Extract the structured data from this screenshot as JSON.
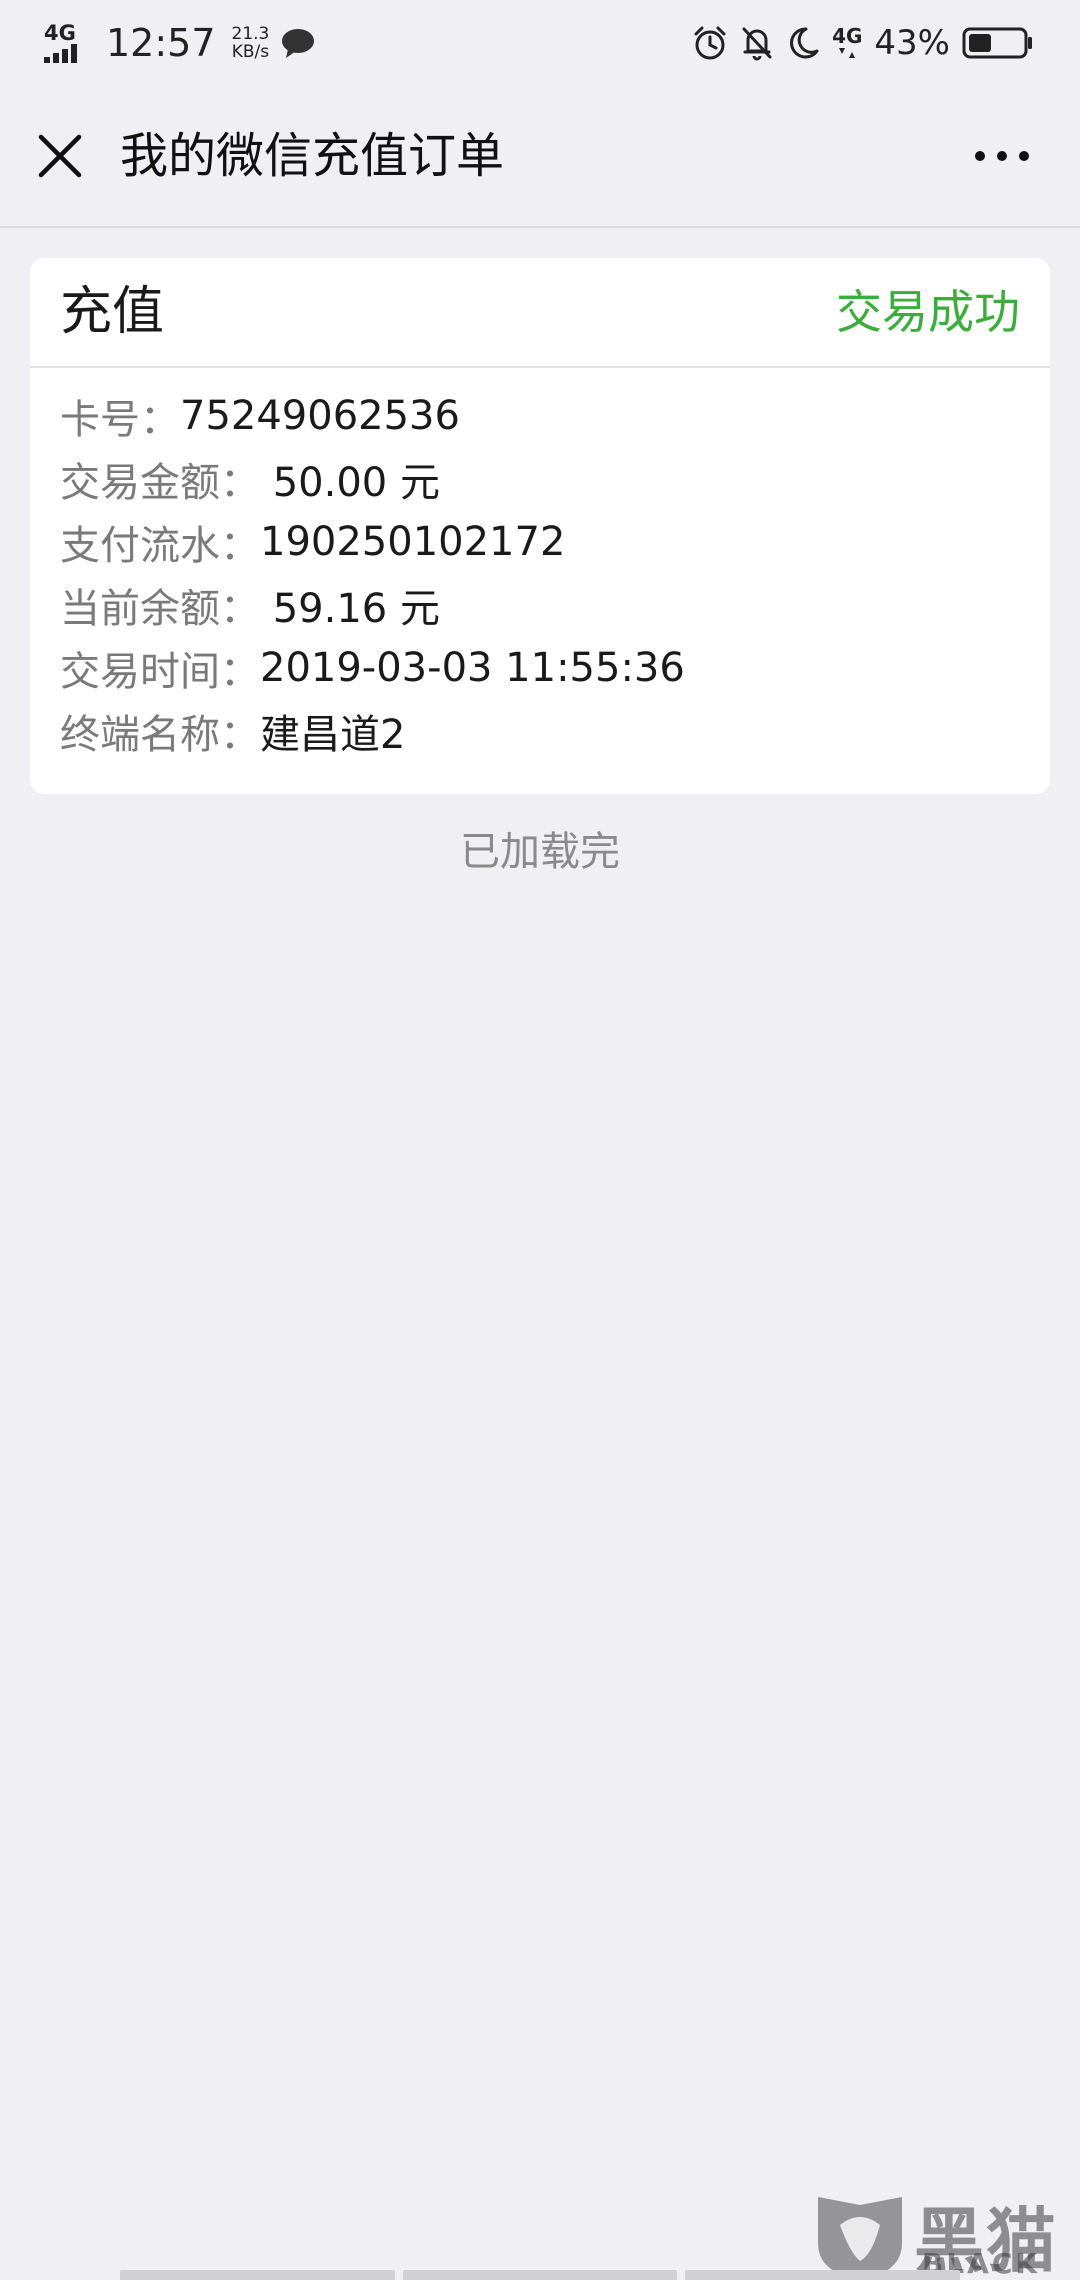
{
  "status_bar": {
    "network_type": "4G",
    "time": "12:57",
    "speed_value": "21.3",
    "speed_unit": "KB/s",
    "network_type_right": "4G",
    "battery_percent": "43%",
    "battery_level": 0.43,
    "icons": [
      "chat-bubble-icon",
      "alarm-icon",
      "bell-off-icon",
      "moon-icon",
      "battery-icon"
    ]
  },
  "nav": {
    "title": "我的微信充值订单",
    "close_icon": "close-icon",
    "more_icon": "more-icon"
  },
  "order": {
    "title": "充值",
    "status": "交易成功",
    "status_color": "#3aad3a",
    "rows": [
      {
        "label": "卡号：",
        "value": "75249062536"
      },
      {
        "label": "交易金额：",
        "value": " 50.00 元"
      },
      {
        "label": "支付流水：",
        "value": "190250102172"
      },
      {
        "label": "当前余额：",
        "value": " 59.16 元"
      },
      {
        "label": "交易时间：",
        "value": "2019-03-03 11:55:36"
      },
      {
        "label": "终端名称：",
        "value": "建昌道2"
      }
    ]
  },
  "footer": {
    "loaded_text": "已加载完"
  },
  "watermark": {
    "cn": "黑猫",
    "en": "BLACK CAT"
  }
}
